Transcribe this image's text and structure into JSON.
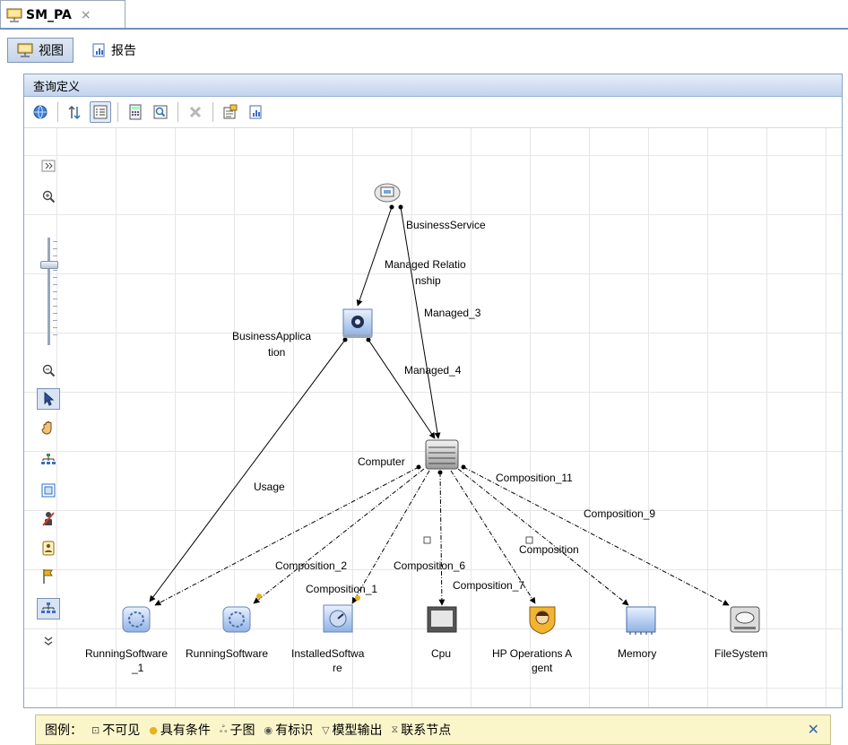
{
  "doc_tab": {
    "title": "SM_PA",
    "close": "×"
  },
  "view_tabs": [
    {
      "label": "视图",
      "icon": "view-icon",
      "active": true
    },
    {
      "label": "报告",
      "icon": "report-icon",
      "active": false
    }
  ],
  "panel": {
    "title": "查询定义"
  },
  "toolbar_icons": [
    "globe-icon",
    "hierarchy-icon",
    "list-view-icon",
    "calculator-icon",
    "search-icon",
    "delete-icon",
    "properties-icon",
    "report-icon"
  ],
  "left_tools": [
    "expand-icon",
    "zoom-in-icon",
    "zoom-slider",
    "zoom-out-icon",
    "select-pointer-icon",
    "pan-hand-icon",
    "layout-tree-icon",
    "fit-to-window-icon",
    "hide-node-icon",
    "node-properties-icon",
    "flag-icon",
    "subgraph-icon",
    "more-icon"
  ],
  "zoom": {
    "level": 0.78
  },
  "graph": {
    "nodes": [
      {
        "id": "bs",
        "label": "BusinessService",
        "icon": "business-service-icon"
      },
      {
        "id": "ba",
        "label1": "BusinessApplica",
        "label2": "tion",
        "icon": "business-application-icon"
      },
      {
        "id": "comp",
        "label": "Computer",
        "icon": "computer-icon"
      },
      {
        "id": "rs1",
        "label1": "RunningSoftware",
        "label2": "_1",
        "icon": "running-software-icon"
      },
      {
        "id": "rs",
        "label": "RunningSoftware",
        "icon": "running-software-icon"
      },
      {
        "id": "is",
        "label1": "InstalledSoftwa",
        "label2": "re",
        "icon": "installed-software-icon"
      },
      {
        "id": "cpu",
        "label": "Cpu",
        "icon": "cpu-icon"
      },
      {
        "id": "hpoa",
        "label1": "HP Operations A",
        "label2": "gent",
        "icon": "hp-agent-icon"
      },
      {
        "id": "mem",
        "label": "Memory",
        "icon": "memory-icon"
      },
      {
        "id": "fs",
        "label": "FileSystem",
        "icon": "filesystem-icon"
      }
    ],
    "edges": [
      {
        "label1": "Managed Relatio",
        "label2": "nship"
      },
      {
        "label": "Managed_3"
      },
      {
        "label": "Managed_4"
      },
      {
        "label": "Usage"
      },
      {
        "label": "Composition_2"
      },
      {
        "label": "Composition_1"
      },
      {
        "label": "Composition_6"
      },
      {
        "label": "Composition_7"
      },
      {
        "label": "Composition"
      },
      {
        "label": "Composition_11"
      },
      {
        "label": "Composition_9"
      }
    ]
  },
  "legend": {
    "title": "图例：",
    "items": [
      {
        "symbol": "⊡",
        "label": "不可见"
      },
      {
        "symbol": "●",
        "label": "具有条件"
      },
      {
        "symbol": "ஃ",
        "label": "子图"
      },
      {
        "symbol": "◉",
        "label": "有标识"
      },
      {
        "symbol": "▽",
        "label": "模型输出"
      },
      {
        "symbol": "⧖",
        "label": "联系节点"
      }
    ],
    "close": "✕"
  },
  "colors": {
    "accent": "#6f8fc0",
    "legend_bg": "#fbf6c9",
    "edge": "#000000"
  }
}
